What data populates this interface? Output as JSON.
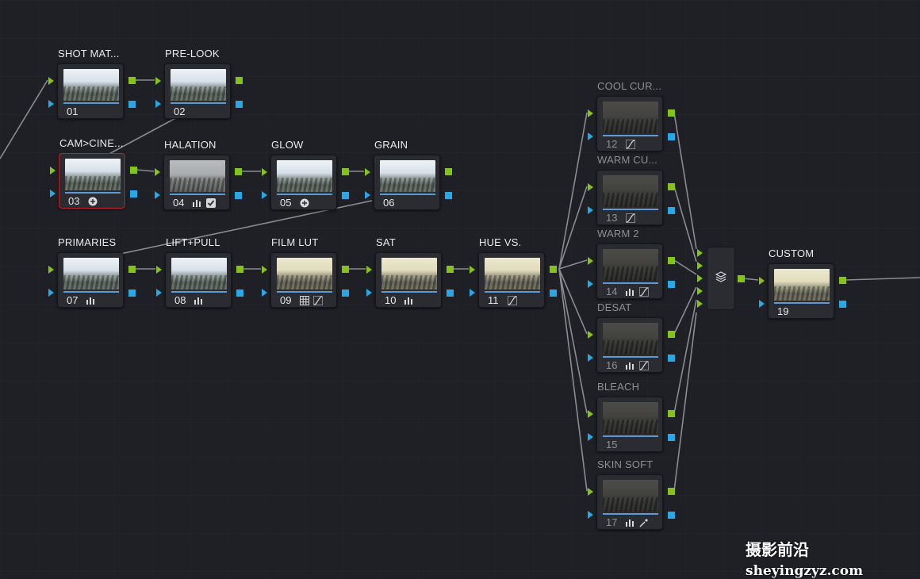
{
  "nodes": [
    {
      "id": "n01",
      "title": "SHOT MAT...",
      "num": "01",
      "icons": [],
      "thumb": "cool"
    },
    {
      "id": "n02",
      "title": "PRE-LOOK",
      "num": "02",
      "icons": [],
      "thumb": "cool"
    },
    {
      "id": "n03",
      "title": "CAM>CINE...",
      "num": "03",
      "icons": [
        "color-space-icon"
      ],
      "thumb": "cool",
      "selected": true
    },
    {
      "id": "n04",
      "title": "HALATION",
      "num": "04",
      "icons": [
        "bars-icon",
        "check-icon"
      ],
      "thumb": "gray"
    },
    {
      "id": "n05",
      "title": "GLOW",
      "num": "05",
      "icons": [
        "color-space-icon"
      ],
      "thumb": "cool"
    },
    {
      "id": "n06",
      "title": "GRAIN",
      "num": "06",
      "icons": [],
      "thumb": "cool"
    },
    {
      "id": "n07",
      "title": "PRIMARIES",
      "num": "07",
      "icons": [
        "bars-icon"
      ],
      "thumb": "cool"
    },
    {
      "id": "n08",
      "title": "LIFT+PULL",
      "num": "08",
      "icons": [
        "bars-icon"
      ],
      "thumb": "cool"
    },
    {
      "id": "n09",
      "title": "FILM LUT",
      "num": "09",
      "icons": [
        "grid-icon",
        "curve-icon"
      ],
      "thumb": "warm"
    },
    {
      "id": "n10",
      "title": "SAT",
      "num": "10",
      "icons": [
        "bars-icon"
      ],
      "thumb": "warm"
    },
    {
      "id": "n11",
      "title": "HUE VS.",
      "num": "11",
      "icons": [
        "curve-icon"
      ],
      "thumb": "warm"
    },
    {
      "id": "n12",
      "title": "COOL CUR...",
      "num": "12",
      "icons": [
        "curve-icon"
      ],
      "thumb": "olive",
      "dim": true
    },
    {
      "id": "n13",
      "title": "WARM CU...",
      "num": "13",
      "icons": [
        "curve-icon"
      ],
      "thumb": "olive",
      "dim": true
    },
    {
      "id": "n14",
      "title": "WARM 2",
      "num": "14",
      "icons": [
        "bars-icon",
        "curve-icon"
      ],
      "thumb": "olive",
      "dim": true
    },
    {
      "id": "n16",
      "title": "DESAT",
      "num": "16",
      "icons": [
        "bars-icon",
        "curve-icon"
      ],
      "thumb": "olive",
      "dim": true
    },
    {
      "id": "n15",
      "title": "BLEACH",
      "num": "15",
      "icons": [],
      "thumb": "olive",
      "dim": true
    },
    {
      "id": "n17",
      "title": "SKIN SOFT",
      "num": "17",
      "icons": [
        "bars-icon",
        "eyedropper-icon"
      ],
      "thumb": "olive",
      "dim": true
    },
    {
      "id": "n19",
      "title": "CUSTOM",
      "num": "19",
      "icons": [],
      "thumb": "warm"
    }
  ],
  "layer_mixer": {
    "icon": "layers-icon"
  },
  "watermark": {
    "cn": "摄影前沿",
    "domain": "sheyingzyz.com"
  },
  "colors": {
    "rgb_port": "#86c21c",
    "alpha_port": "#2aa7e4",
    "wire": "#8a8b8f",
    "selected_border": "#b7272d",
    "bar": "#5e9bd6"
  }
}
